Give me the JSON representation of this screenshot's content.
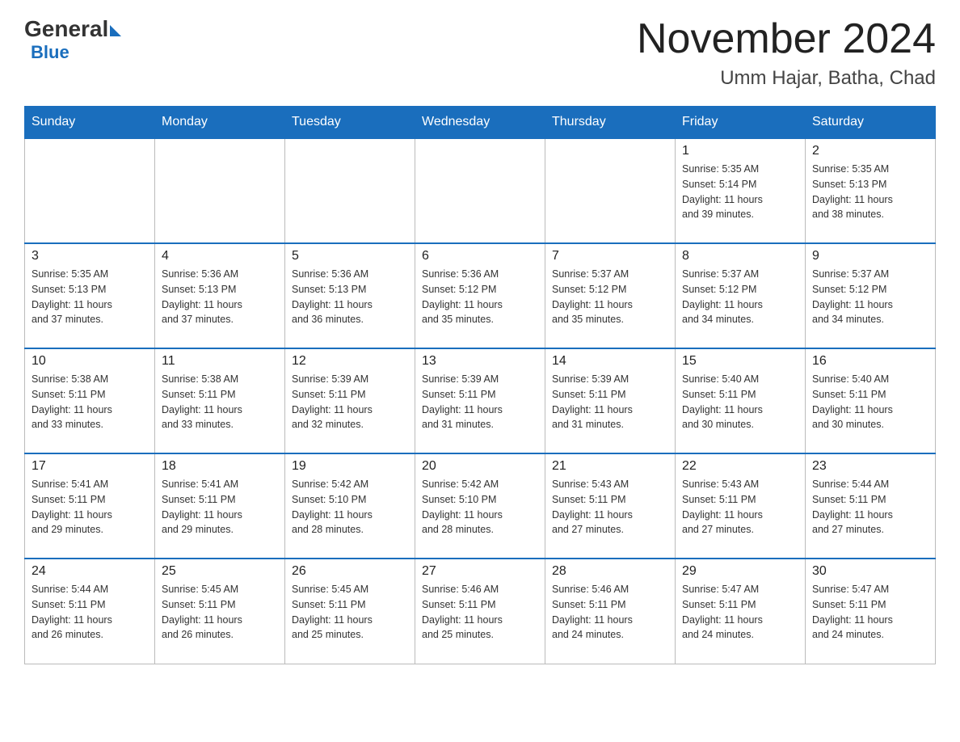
{
  "header": {
    "logo_general": "General",
    "logo_blue": "Blue",
    "month_title": "November 2024",
    "location": "Umm Hajar, Batha, Chad"
  },
  "days_of_week": [
    "Sunday",
    "Monday",
    "Tuesday",
    "Wednesday",
    "Thursday",
    "Friday",
    "Saturday"
  ],
  "weeks": [
    [
      {
        "day": "",
        "info": ""
      },
      {
        "day": "",
        "info": ""
      },
      {
        "day": "",
        "info": ""
      },
      {
        "day": "",
        "info": ""
      },
      {
        "day": "",
        "info": ""
      },
      {
        "day": "1",
        "info": "Sunrise: 5:35 AM\nSunset: 5:14 PM\nDaylight: 11 hours\nand 39 minutes."
      },
      {
        "day": "2",
        "info": "Sunrise: 5:35 AM\nSunset: 5:13 PM\nDaylight: 11 hours\nand 38 minutes."
      }
    ],
    [
      {
        "day": "3",
        "info": "Sunrise: 5:35 AM\nSunset: 5:13 PM\nDaylight: 11 hours\nand 37 minutes."
      },
      {
        "day": "4",
        "info": "Sunrise: 5:36 AM\nSunset: 5:13 PM\nDaylight: 11 hours\nand 37 minutes."
      },
      {
        "day": "5",
        "info": "Sunrise: 5:36 AM\nSunset: 5:13 PM\nDaylight: 11 hours\nand 36 minutes."
      },
      {
        "day": "6",
        "info": "Sunrise: 5:36 AM\nSunset: 5:12 PM\nDaylight: 11 hours\nand 35 minutes."
      },
      {
        "day": "7",
        "info": "Sunrise: 5:37 AM\nSunset: 5:12 PM\nDaylight: 11 hours\nand 35 minutes."
      },
      {
        "day": "8",
        "info": "Sunrise: 5:37 AM\nSunset: 5:12 PM\nDaylight: 11 hours\nand 34 minutes."
      },
      {
        "day": "9",
        "info": "Sunrise: 5:37 AM\nSunset: 5:12 PM\nDaylight: 11 hours\nand 34 minutes."
      }
    ],
    [
      {
        "day": "10",
        "info": "Sunrise: 5:38 AM\nSunset: 5:11 PM\nDaylight: 11 hours\nand 33 minutes."
      },
      {
        "day": "11",
        "info": "Sunrise: 5:38 AM\nSunset: 5:11 PM\nDaylight: 11 hours\nand 33 minutes."
      },
      {
        "day": "12",
        "info": "Sunrise: 5:39 AM\nSunset: 5:11 PM\nDaylight: 11 hours\nand 32 minutes."
      },
      {
        "day": "13",
        "info": "Sunrise: 5:39 AM\nSunset: 5:11 PM\nDaylight: 11 hours\nand 31 minutes."
      },
      {
        "day": "14",
        "info": "Sunrise: 5:39 AM\nSunset: 5:11 PM\nDaylight: 11 hours\nand 31 minutes."
      },
      {
        "day": "15",
        "info": "Sunrise: 5:40 AM\nSunset: 5:11 PM\nDaylight: 11 hours\nand 30 minutes."
      },
      {
        "day": "16",
        "info": "Sunrise: 5:40 AM\nSunset: 5:11 PM\nDaylight: 11 hours\nand 30 minutes."
      }
    ],
    [
      {
        "day": "17",
        "info": "Sunrise: 5:41 AM\nSunset: 5:11 PM\nDaylight: 11 hours\nand 29 minutes."
      },
      {
        "day": "18",
        "info": "Sunrise: 5:41 AM\nSunset: 5:11 PM\nDaylight: 11 hours\nand 29 minutes."
      },
      {
        "day": "19",
        "info": "Sunrise: 5:42 AM\nSunset: 5:10 PM\nDaylight: 11 hours\nand 28 minutes."
      },
      {
        "day": "20",
        "info": "Sunrise: 5:42 AM\nSunset: 5:10 PM\nDaylight: 11 hours\nand 28 minutes."
      },
      {
        "day": "21",
        "info": "Sunrise: 5:43 AM\nSunset: 5:11 PM\nDaylight: 11 hours\nand 27 minutes."
      },
      {
        "day": "22",
        "info": "Sunrise: 5:43 AM\nSunset: 5:11 PM\nDaylight: 11 hours\nand 27 minutes."
      },
      {
        "day": "23",
        "info": "Sunrise: 5:44 AM\nSunset: 5:11 PM\nDaylight: 11 hours\nand 27 minutes."
      }
    ],
    [
      {
        "day": "24",
        "info": "Sunrise: 5:44 AM\nSunset: 5:11 PM\nDaylight: 11 hours\nand 26 minutes."
      },
      {
        "day": "25",
        "info": "Sunrise: 5:45 AM\nSunset: 5:11 PM\nDaylight: 11 hours\nand 26 minutes."
      },
      {
        "day": "26",
        "info": "Sunrise: 5:45 AM\nSunset: 5:11 PM\nDaylight: 11 hours\nand 25 minutes."
      },
      {
        "day": "27",
        "info": "Sunrise: 5:46 AM\nSunset: 5:11 PM\nDaylight: 11 hours\nand 25 minutes."
      },
      {
        "day": "28",
        "info": "Sunrise: 5:46 AM\nSunset: 5:11 PM\nDaylight: 11 hours\nand 24 minutes."
      },
      {
        "day": "29",
        "info": "Sunrise: 5:47 AM\nSunset: 5:11 PM\nDaylight: 11 hours\nand 24 minutes."
      },
      {
        "day": "30",
        "info": "Sunrise: 5:47 AM\nSunset: 5:11 PM\nDaylight: 11 hours\nand 24 minutes."
      }
    ]
  ]
}
